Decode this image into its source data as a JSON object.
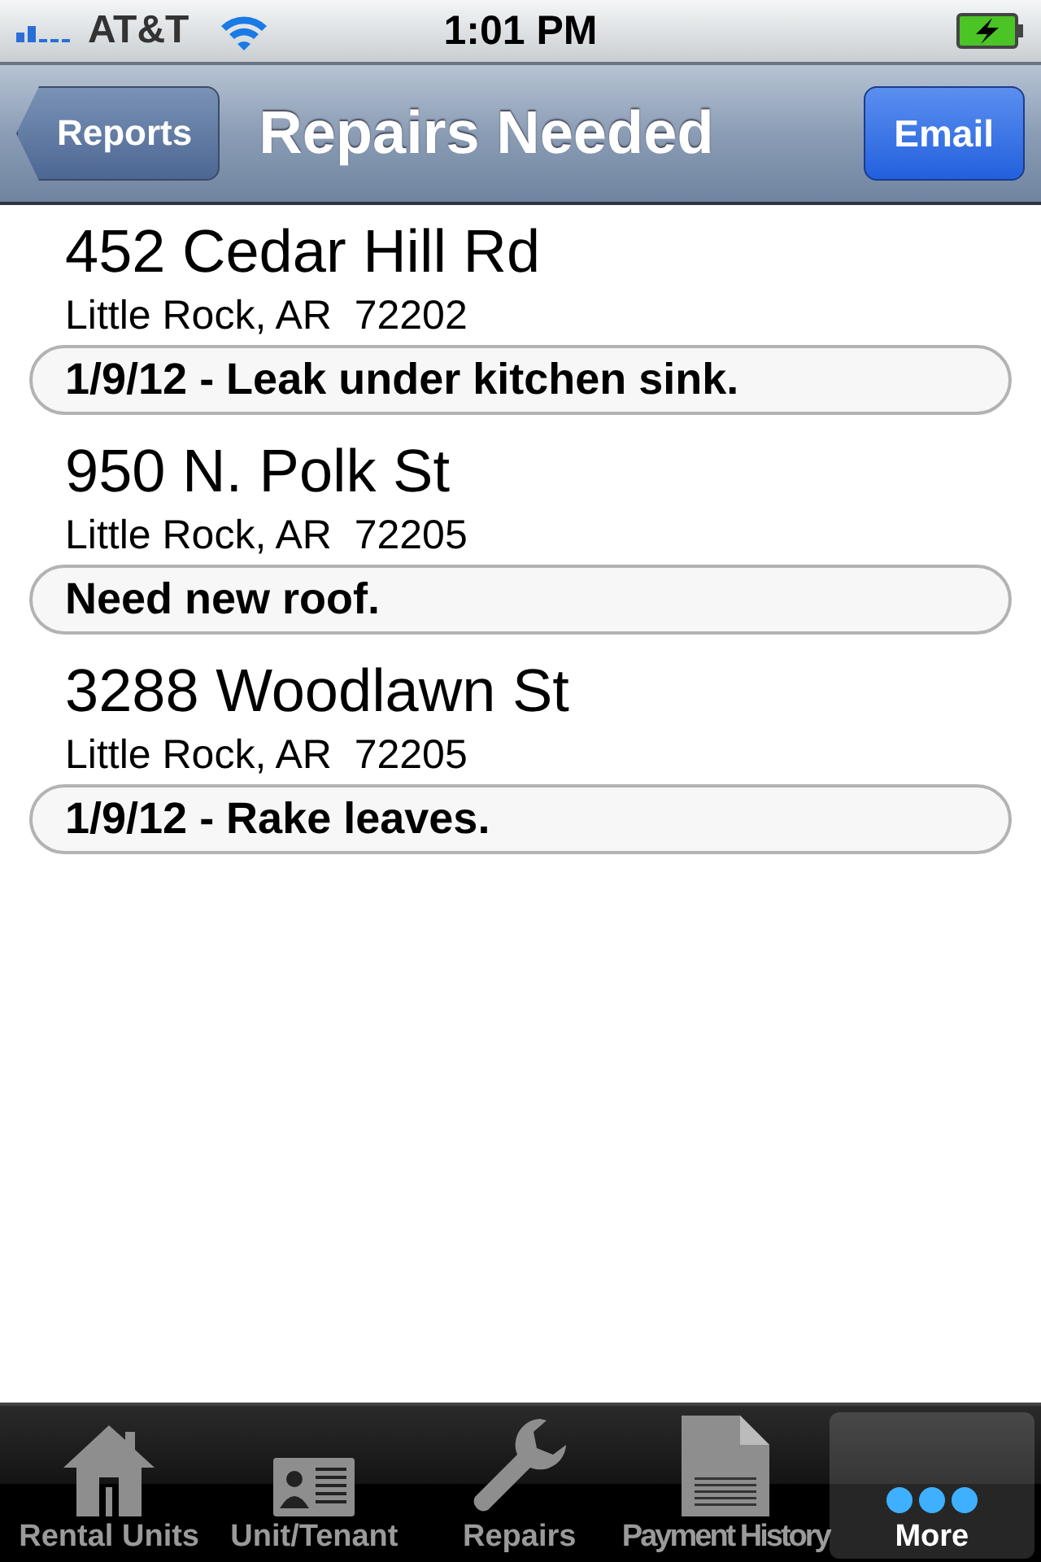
{
  "status_bar": {
    "carrier": "AT&T",
    "time": "1:01 PM"
  },
  "nav_bar": {
    "back_button": "Reports",
    "title": "Repairs Needed",
    "action_button": "Email"
  },
  "repairs": [
    {
      "address": "452 Cedar Hill Rd",
      "city": "Little Rock, AR  72202",
      "note": "1/9/12 - Leak under kitchen sink."
    },
    {
      "address": "950 N. Polk St",
      "city": "Little Rock, AR  72205",
      "note": "Need new roof."
    },
    {
      "address": "3288 Woodlawn St",
      "city": "Little Rock, AR  72205",
      "note": "1/9/12 - Rake leaves."
    }
  ],
  "tab_bar": [
    {
      "kind": "house",
      "label": "Rental Units",
      "selected": false
    },
    {
      "kind": "card",
      "label": "Unit/Tenant",
      "selected": false
    },
    {
      "kind": "wrench",
      "label": "Repairs",
      "selected": false
    },
    {
      "kind": "document",
      "label": "Payment History",
      "selected": false
    },
    {
      "kind": "more",
      "label": "More",
      "selected": true
    }
  ]
}
